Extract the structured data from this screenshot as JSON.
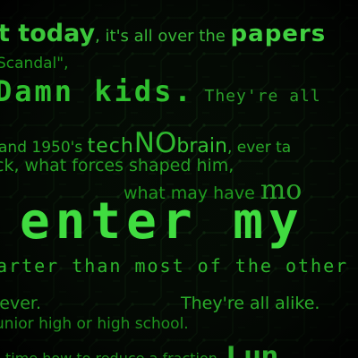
{
  "lines": {
    "l1": {
      "a": "t today",
      "b": ", it's all over the ",
      "c": "papers"
    },
    "l2": "Scandal\",",
    "l3": {
      "a": "Damn kids",
      "b": ".",
      "c": " They're all"
    },
    "l4": {
      "a": "and 1950's ",
      "b": "tech",
      "c": "NO",
      "d": "brain",
      "e": ", ever ta"
    },
    "l5": "ck, what forces shaped him,",
    "l6": {
      "a": "what may have ",
      "b": "mo"
    },
    "l7": "enter my",
    "l8": "arter than most of the other",
    "l9": {
      "a": "iever.",
      "b": "They're all alike."
    },
    "l10": "unior high or high school.",
    "l11": {
      "a": "time how to reduce a fraction. ",
      "b": "I un"
    }
  },
  "colors": {
    "background": "#030603",
    "accent": "#40dc40"
  }
}
